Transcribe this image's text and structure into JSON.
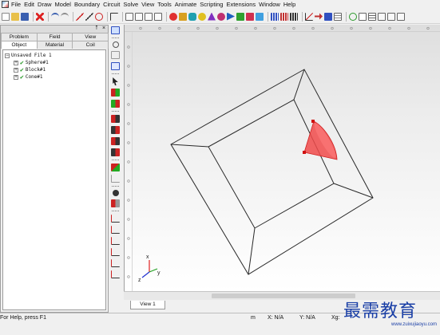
{
  "menu": [
    "File",
    "Edit",
    "Draw",
    "Model",
    "Boundary",
    "Circuit",
    "Solve",
    "View",
    "Tools",
    "Animate",
    "Scripting",
    "Extensions",
    "Window",
    "Help"
  ],
  "panel": {
    "title_pin": "⭡",
    "title_close": "×",
    "tabs_top": [
      "Problem",
      "Field",
      "View"
    ],
    "tabs_bottom": [
      "Object",
      "Material",
      "Coil"
    ],
    "active_tab": "Object",
    "tree": {
      "root": "Unsaved File 1",
      "items": [
        "Sphere#1",
        "Block#1",
        "Cone#1"
      ]
    }
  },
  "viewport": {
    "view_tab": "View 1",
    "axis_labels": {
      "x": "x",
      "y": "y",
      "z": "z"
    }
  },
  "status": {
    "help": "For Help, press F1",
    "unit": "m",
    "x": "X: N/A",
    "y": "Y: N/A",
    "xg": "Xg:"
  },
  "watermark": {
    "text": "最需教育",
    "url": "www.zuixujiaoyu.com"
  },
  "colors": {
    "cone": "#f04a4a",
    "wireframe": "#2a2a2a",
    "axis_x": "#e02020",
    "axis_y": "#20a020",
    "axis_z": "#2030d0"
  }
}
